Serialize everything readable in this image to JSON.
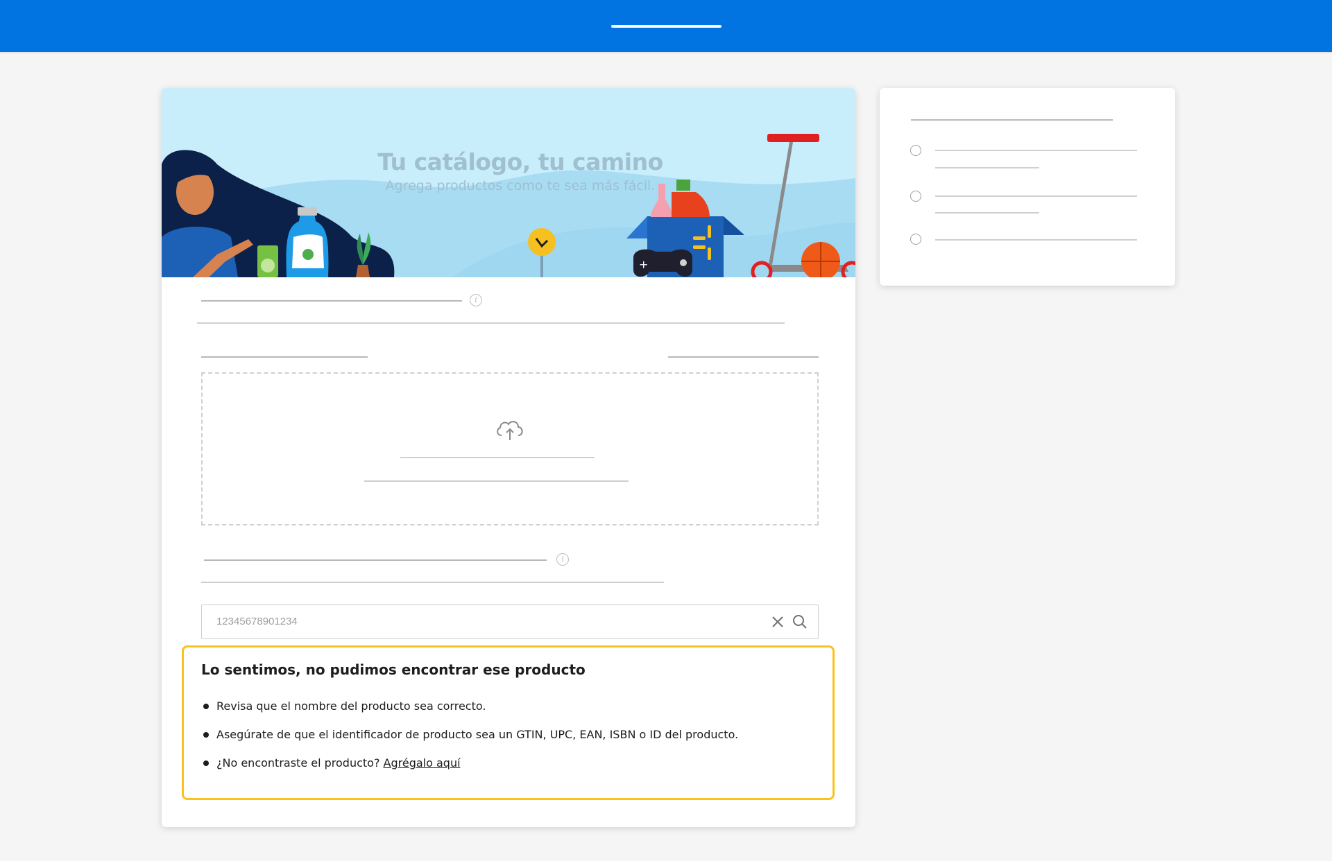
{
  "hero": {
    "title": "Tu catálogo, tu camino",
    "subtitle": "Agrega productos como te sea más fácil."
  },
  "search": {
    "value": "12345678901234",
    "clear_icon": "close-icon",
    "search_icon": "search-icon"
  },
  "upload": {
    "icon": "cloud-upload-icon"
  },
  "alert": {
    "title": "Lo sentimos, no pudimos encontrar ese producto",
    "items": [
      "Revisa que el nombre del producto sea correcto.",
      "Asegúrate de que el identificador de producto sea un GTIN, UPC, EAN, ISBN o ID del producto.",
      "¿No encontraste el producto?"
    ],
    "link_label": "Agrégalo aquí",
    "border_color": "#fcc21b"
  },
  "colors": {
    "brand_blue": "#0174e1",
    "hero_background": "#c8eefb"
  }
}
